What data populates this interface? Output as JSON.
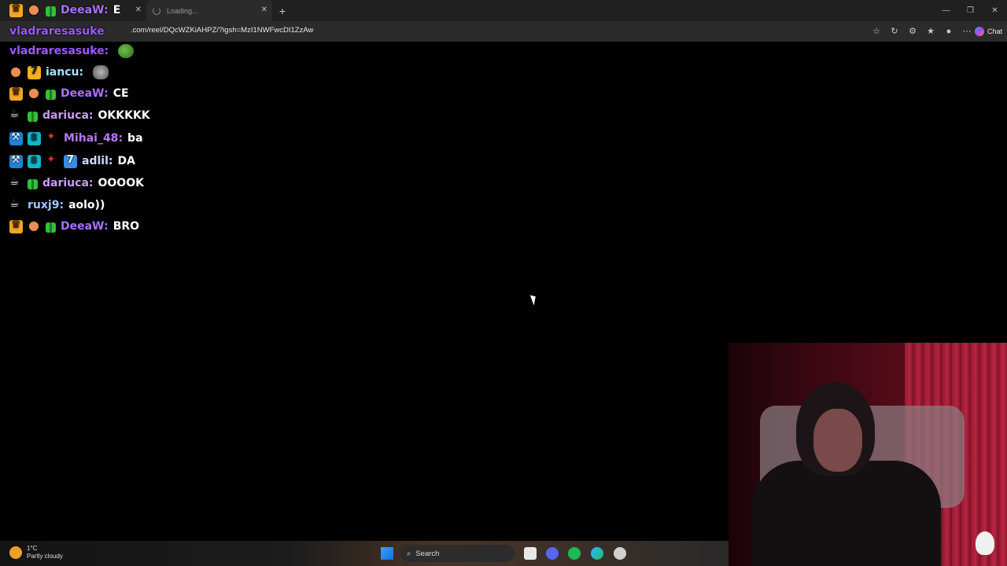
{
  "browser": {
    "tab_active_title": "",
    "tab_loading_title": "Loading...",
    "url": ".com/reel/DQcWZKiAHPZ/?igsh=MzI1NWFwcDI1ZzAw",
    "chat_button_label": "Chat"
  },
  "chat": [
    {
      "user": "DeeaW",
      "text": "E",
      "badges": [
        "crown-badge",
        "cat-badge",
        "gift-badge"
      ],
      "user_color": "#a970ff"
    },
    {
      "user": "vladraresasuke",
      "text": "",
      "badges": [],
      "user_color": "#9b59ff",
      "emote": "pepe-emote"
    },
    {
      "user": "vladraresasuke",
      "text": "",
      "badges": [],
      "user_color": "#9b59ff",
      "emote": "pepe-emote"
    },
    {
      "user": "iancu",
      "text": "",
      "badges": [
        "cat-badge",
        "seven-badge"
      ],
      "user_color": "#9fe3ff",
      "emote": "cat-emote"
    },
    {
      "user": "DeeaW",
      "text": "CE",
      "badges": [
        "crown-badge",
        "cat-badge",
        "gift-badge"
      ],
      "user_color": "#a970ff"
    },
    {
      "user": "dariuca",
      "text": "OKKKKK",
      "badges": [
        "cup-badge",
        "gift-badge"
      ],
      "user_color": "#c79cf2"
    },
    {
      "user": "Mihai_48",
      "text": "ba",
      "badges": [
        "hammer-badge",
        "sub-badge",
        "gun-badge"
      ],
      "user_color": "#b47af0"
    },
    {
      "user": "adlil",
      "text": "DA",
      "badges": [
        "hammer-badge",
        "sub-badge",
        "gun-badge",
        "blue7-badge"
      ],
      "user_color": "#c8dcff"
    },
    {
      "user": "dariuca",
      "text": "OOOOK",
      "badges": [
        "cup-badge",
        "gift-badge"
      ],
      "user_color": "#c79cf2"
    },
    {
      "user": "ruxj9",
      "text": "aolo))",
      "badges": [
        "cup-badge"
      ],
      "user_color": "#9ec8ff"
    },
    {
      "user": "DeeaW",
      "text": "BRO",
      "badges": [
        "crown-badge",
        "cat-badge",
        "gift-badge"
      ],
      "user_color": "#a970ff"
    }
  ],
  "taskbar": {
    "temp": "1°C",
    "weather": "Partly cloudy",
    "search_label": "Search"
  }
}
